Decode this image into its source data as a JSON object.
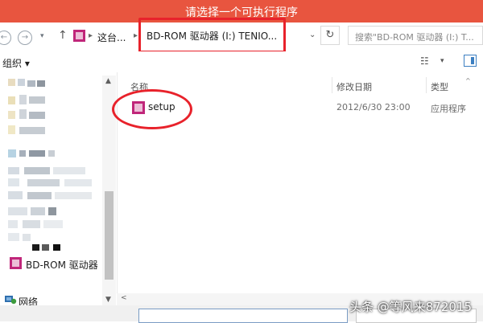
{
  "window": {
    "title": "请选择一个可执行程序"
  },
  "nav": {
    "back_icon": "arrow-left-icon",
    "forward_icon": "arrow-right-icon",
    "recent_icon": "chevron-down-icon",
    "up_icon": "arrow-up-icon",
    "drive_icon": "disc-drive-icon",
    "crumb_this_pc": "这台...",
    "crumb_current": "BD-ROM 驱动器 (I:) TENIO...",
    "search_placeholder": "搜索\"BD-ROM 驱动器 (I:) T..."
  },
  "toolbar": {
    "organize_label": "组织 ▾",
    "view_icon": "view-list-icon",
    "pane_icon": "preview-pane-icon"
  },
  "sidebar": {
    "items": [
      {
        "label": "BD-ROM 驱动器",
        "icon": "disc-drive-icon"
      },
      {
        "label": "网络",
        "icon": "network-icon"
      }
    ]
  },
  "file_list": {
    "columns": [
      {
        "label": "名称"
      },
      {
        "label": "修改日期"
      },
      {
        "label": "类型"
      }
    ],
    "rows": [
      {
        "name": "setup",
        "modified": "2012/6/30 23:00",
        "type": "应用程序",
        "icon": "setup-app-icon"
      }
    ]
  },
  "watermark": "头条 @等风来872015",
  "colors": {
    "title_bar": "#e8553f",
    "annotation_red": "#e8222b",
    "drive_icon": "#c0267a"
  }
}
